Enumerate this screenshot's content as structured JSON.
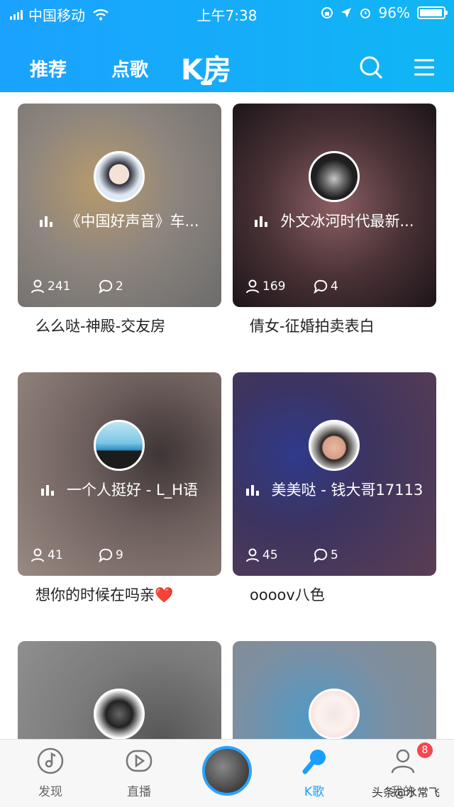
{
  "status_bar": {
    "carrier": "中国移动",
    "time": "上午7:38",
    "battery": "96%",
    "battery_level": 0.96
  },
  "nav": {
    "tabs": [
      {
        "label": "推荐"
      },
      {
        "label": "点歌"
      },
      {
        "label": "K房"
      }
    ],
    "active_tab": "K房"
  },
  "rooms": [
    {
      "song": "《中国好声音》车...",
      "listeners": "241",
      "comments": "2",
      "name": "么么哒-神殿-交友房",
      "bg": "#9a9592"
    },
    {
      "song": "外文冰河时代最新...",
      "listeners": "169",
      "comments": "4",
      "name": "倩女-征婚拍卖表白",
      "bg": "#3a2a2c"
    },
    {
      "song": "一个人挺好 - L_H语",
      "listeners": "41",
      "comments": "9",
      "name": "想你的时候在吗亲",
      "bg": "#7a6a66"
    },
    {
      "song": "美美哒 - 钱大哥17113",
      "listeners": "45",
      "comments": "5",
      "name": "oooov八色",
      "bg": "#3d3460"
    },
    {
      "song": "",
      "listeners": "",
      "comments": "",
      "name": "",
      "bg": "#8a8a8a"
    },
    {
      "song": "",
      "listeners": "",
      "comments": "",
      "name": "",
      "bg": "#7a8a9a"
    }
  ],
  "name_emoji": "❤️",
  "tabbar": {
    "items": [
      {
        "label": "发现"
      },
      {
        "label": "直播"
      },
      {
        "label": ""
      },
      {
        "label": "K歌"
      },
      {
        "label": "我的"
      }
    ],
    "badge": "8",
    "active": "K歌"
  },
  "watermark": "头条@水常飞",
  "colors": {
    "accent": "#1a9eff",
    "header": "#14aaf8",
    "badge": "#f5474f"
  }
}
